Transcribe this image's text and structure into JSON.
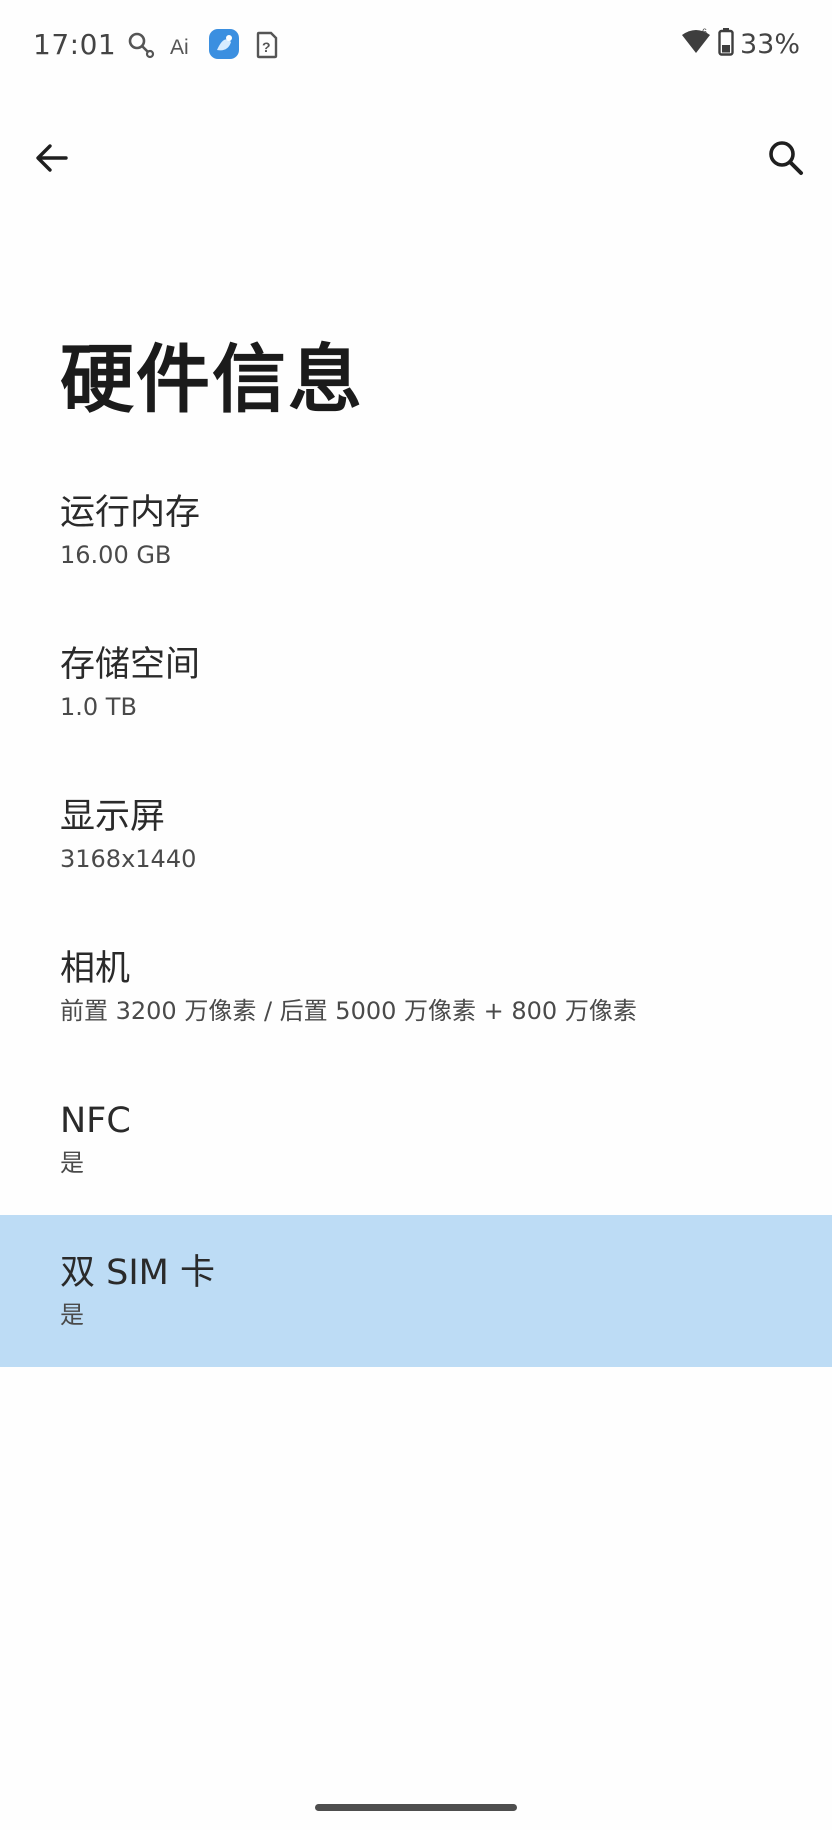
{
  "status_bar": {
    "time": "17:01",
    "battery_percent": "33%",
    "icons": [
      "key-icon",
      "ai-icon",
      "app-badge-icon",
      "sim-question-icon",
      "wifi-icon",
      "battery-icon"
    ]
  },
  "app_bar": {
    "back_icon": "arrow-left-icon",
    "search_icon": "search-icon"
  },
  "page": {
    "title": "硬件信息"
  },
  "items": [
    {
      "title": "运行内存",
      "value": "16.00 GB"
    },
    {
      "title": "存储空间",
      "value": "1.0 TB"
    },
    {
      "title": "显示屏",
      "value": "3168x1440"
    },
    {
      "title": "相机",
      "value": "前置 3200 万像素 / 后置 5000 万像素 + 800 万像素"
    },
    {
      "title": "NFC",
      "value": "是"
    },
    {
      "title": "双 SIM 卡",
      "value": "是"
    }
  ],
  "colors": {
    "highlight": "#bddcf5",
    "background": "#fefefe",
    "app_badge": "#3b8fe0"
  }
}
